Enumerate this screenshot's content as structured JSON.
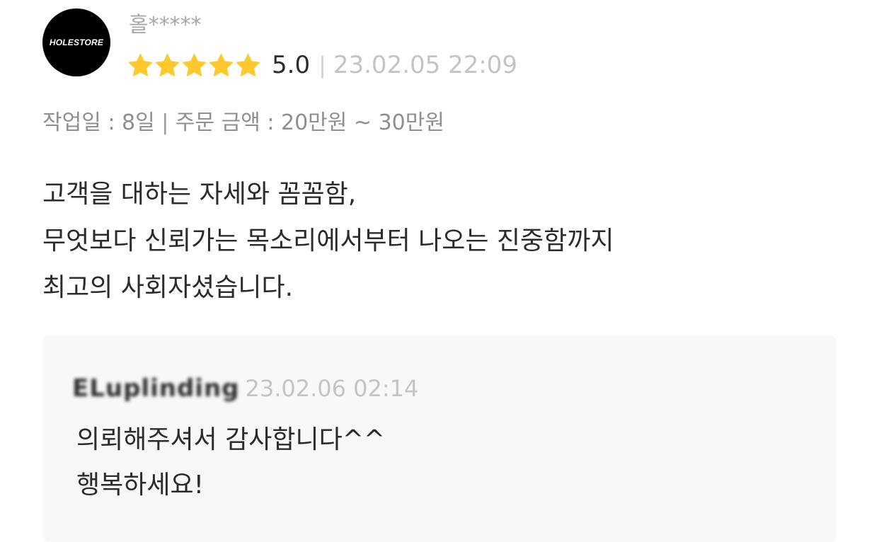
{
  "review": {
    "avatar_logo_text": "HOLESTORE",
    "reviewer_name": "홀*****",
    "rating_stars": 5,
    "star_color": "#FFC82C",
    "score": "5.0",
    "separator": "|",
    "date": "23.02.05 22:09",
    "meta": {
      "work_days_label": "작업일 : 8일",
      "separator": "|",
      "order_amount_label": "주문 금액 : 20만원 ~ 30만원"
    },
    "text_lines": [
      "고객을 대하는 자세와 꼼꼼함,",
      "무엇보다 신뢰가는 목소리에서부터 나오는 진중함까지",
      "최고의 사회자셨습니다."
    ]
  },
  "reply": {
    "seller_name": "ELuplinding",
    "date": "23.02.06 02:14",
    "text_lines": [
      "의뢰해주셔서 감사합니다^^",
      "행복하세요!"
    ]
  }
}
